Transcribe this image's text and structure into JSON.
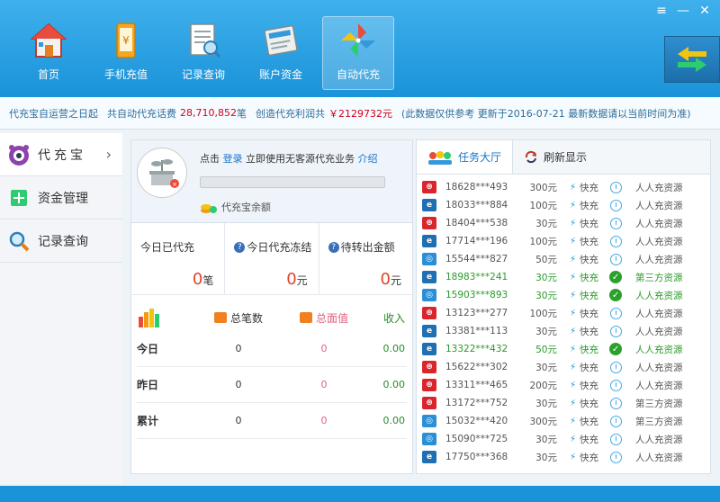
{
  "nav": [
    {
      "label": "首页",
      "icon": "house-icon"
    },
    {
      "label": "手机充值",
      "icon": "phone-icon"
    },
    {
      "label": "记录查询",
      "icon": "records-icon"
    },
    {
      "label": "账户资金",
      "icon": "ledger-icon"
    },
    {
      "label": "自动代充",
      "icon": "pinwheel-icon"
    }
  ],
  "window_controls": {
    "menu": "≡",
    "minimize": "—",
    "close": "✕"
  },
  "infobar": {
    "t1": "代充宝自运营之日起",
    "t2": "共自动代充话费",
    "total": "28,710,852",
    "unit1": "笔",
    "t3": "创造代充利润共",
    "profit": "￥2129732元",
    "t4": "(此数据仅供参考 更新于2016-07-21 最新数据请以当前时间为准)"
  },
  "sidebar": [
    {
      "label": "代充宝",
      "icon": "daichongbao-icon"
    },
    {
      "label": "资金管理",
      "icon": "plus-box-icon"
    },
    {
      "label": "记录查询",
      "icon": "magnifier-icon"
    }
  ],
  "login": {
    "prefix": "点击",
    "link": "登录",
    "middle": "立即使用无客源代充业务",
    "intro": "介绍",
    "balance_label": "代充宝余额",
    "progress": 0
  },
  "stats": [
    {
      "label": "今日已代充",
      "value": "0",
      "unit": "笔",
      "help": false
    },
    {
      "label": "今日代充冻结",
      "value": "0",
      "unit": "元",
      "help": true
    },
    {
      "label": "待转出金额",
      "value": "0",
      "unit": "元",
      "help": true
    }
  ],
  "summary": {
    "headers": {
      "count": "总笔数",
      "amount": "总面值",
      "income": "收入"
    },
    "rows": [
      {
        "label": "今日",
        "count": "0",
        "amount": "0",
        "income": "0.00"
      },
      {
        "label": "昨日",
        "count": "0",
        "amount": "0",
        "income": "0.00"
      },
      {
        "label": "累计",
        "count": "0",
        "amount": "0",
        "income": "0.00"
      }
    ]
  },
  "tabs": {
    "tasks": "任务大厅",
    "refresh": "刷新显示"
  },
  "colors": {
    "unicom": "#d9262c",
    "telecom": "#1f6fb5",
    "mobile": "#2a8fd6"
  },
  "orders": [
    {
      "op": "unicom",
      "phone": "18628***493",
      "amount": "300元",
      "speed": "快充",
      "status": "pending",
      "source": "人人充资源"
    },
    {
      "op": "telecom",
      "phone": "18033***884",
      "amount": "100元",
      "speed": "快充",
      "status": "pending",
      "source": "人人充资源"
    },
    {
      "op": "unicom",
      "phone": "18404***538",
      "amount": "30元",
      "speed": "快充",
      "status": "pending",
      "source": "人人充资源"
    },
    {
      "op": "telecom",
      "phone": "17714***196",
      "amount": "100元",
      "speed": "快充",
      "status": "pending",
      "source": "人人充资源"
    },
    {
      "op": "mobile",
      "phone": "15544***827",
      "amount": "50元",
      "speed": "快充",
      "status": "pending",
      "source": "人人充资源"
    },
    {
      "op": "telecom",
      "phone": "18983***241",
      "amount": "30元",
      "speed": "快充",
      "status": "done",
      "source": "第三方资源"
    },
    {
      "op": "mobile",
      "phone": "15903***893",
      "amount": "30元",
      "speed": "快充",
      "status": "done",
      "source": "人人充资源"
    },
    {
      "op": "unicom",
      "phone": "13123***277",
      "amount": "100元",
      "speed": "快充",
      "status": "pending",
      "source": "人人充资源"
    },
    {
      "op": "telecom",
      "phone": "13381***113",
      "amount": "30元",
      "speed": "快充",
      "status": "pending",
      "source": "人人充资源"
    },
    {
      "op": "telecom",
      "phone": "13322***432",
      "amount": "50元",
      "speed": "快充",
      "status": "done",
      "source": "人人充资源"
    },
    {
      "op": "unicom",
      "phone": "15622***302",
      "amount": "30元",
      "speed": "快充",
      "status": "pending",
      "source": "人人充资源"
    },
    {
      "op": "unicom",
      "phone": "13311***465",
      "amount": "200元",
      "speed": "快充",
      "status": "pending",
      "source": "人人充资源"
    },
    {
      "op": "unicom",
      "phone": "13172***752",
      "amount": "30元",
      "speed": "快充",
      "status": "pending",
      "source": "第三方资源"
    },
    {
      "op": "mobile",
      "phone": "15032***420",
      "amount": "300元",
      "speed": "快充",
      "status": "pending",
      "source": "第三方资源"
    },
    {
      "op": "mobile",
      "phone": "15090***725",
      "amount": "30元",
      "speed": "快充",
      "status": "pending",
      "source": "人人充资源"
    },
    {
      "op": "telecom",
      "phone": "17750***368",
      "amount": "30元",
      "speed": "快充",
      "status": "pending",
      "source": "人人充资源"
    }
  ]
}
